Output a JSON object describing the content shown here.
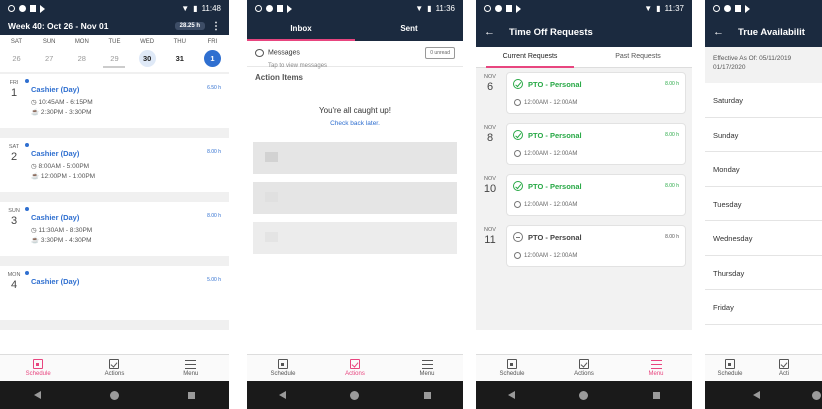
{
  "status": {
    "icons": [
      "circle-icon",
      "sync-icon",
      "sd-card-icon",
      "play-icon"
    ],
    "wifi": "▼",
    "times": [
      "11:48",
      "11:36",
      "11:37",
      ""
    ]
  },
  "schedule": {
    "week_title": "Week 40: Oct 26 - Nov 01",
    "hours": "28.25 h",
    "menu_glyph": "⋮",
    "days": [
      {
        "dow": "SAT",
        "num": "26",
        "state": "past"
      },
      {
        "dow": "SUN",
        "num": "27",
        "state": "past"
      },
      {
        "dow": "MON",
        "num": "28",
        "state": "past"
      },
      {
        "dow": "TUE",
        "num": "29",
        "state": "past"
      },
      {
        "dow": "WED",
        "num": "30",
        "state": "light"
      },
      {
        "dow": "THU",
        "num": "31",
        "state": "current"
      },
      {
        "dow": "FRI",
        "num": "1",
        "state": "selected"
      }
    ],
    "shifts": [
      {
        "dow": "FRI",
        "num": "1",
        "title": "Cashier (Day)",
        "hours": "6.50 h",
        "time": "10:45AM - 6:15PM",
        "break": "2:30PM - 3:30PM"
      },
      {
        "dow": "SAT",
        "num": "2",
        "title": "Cashier (Day)",
        "hours": "8.00 h",
        "time": "8:00AM - 5:00PM",
        "break": "12:00PM - 1:00PM"
      },
      {
        "dow": "SUN",
        "num": "3",
        "title": "Cashier (Day)",
        "hours": "8.00 h",
        "time": "11:30AM - 8:30PM",
        "break": "3:30PM - 4:30PM"
      },
      {
        "dow": "MON",
        "num": "4",
        "title": "Cashier (Day)",
        "hours": "5.00 h",
        "time": "",
        "break": ""
      }
    ]
  },
  "tabs": {
    "schedule": "Schedule",
    "actions": "Actions",
    "menu": "Menu"
  },
  "inbox": {
    "tab_inbox": "Inbox",
    "tab_sent": "Sent",
    "messages_title": "Messages",
    "messages_sub": "Tap to view messages",
    "unread": "0 unread",
    "action_items": "Action Items",
    "caught_up": "You're all caught up!",
    "check_later": "Check back later."
  },
  "timeoff": {
    "title": "Time Off Requests",
    "tab_current": "Current Requests",
    "tab_past": "Past Requests",
    "requests": [
      {
        "mon": "NOV",
        "num": "6",
        "title": "PTO - Personal",
        "hours": "8.00 h",
        "time": "12:00AM - 12:00AM",
        "status": "approved"
      },
      {
        "mon": "NOV",
        "num": "8",
        "title": "PTO - Personal",
        "hours": "8.00 h",
        "time": "12:00AM - 12:00AM",
        "status": "approved"
      },
      {
        "mon": "NOV",
        "num": "10",
        "title": "PTO - Personal",
        "hours": "8.00 h",
        "time": "12:00AM - 12:00AM",
        "status": "approved"
      },
      {
        "mon": "NOV",
        "num": "11",
        "title": "PTO - Personal",
        "hours": "8.00 h",
        "time": "12:00AM - 12:00AM",
        "status": "pending"
      }
    ]
  },
  "availability": {
    "title": "True Availabilit",
    "effective": "Effective As Of: 05/11/2019",
    "effective2": "01/17/2020",
    "days": [
      "Saturday",
      "Sunday",
      "Monday",
      "Tuesday",
      "Wednesday",
      "Thursday",
      "Friday"
    ],
    "tab_schedule": "Schedule",
    "tab_actions": "Acti"
  },
  "colors": {
    "header": "#1b2a3f",
    "accent": "#e8457f",
    "blue": "#2f6fd0",
    "green": "#27a845"
  }
}
